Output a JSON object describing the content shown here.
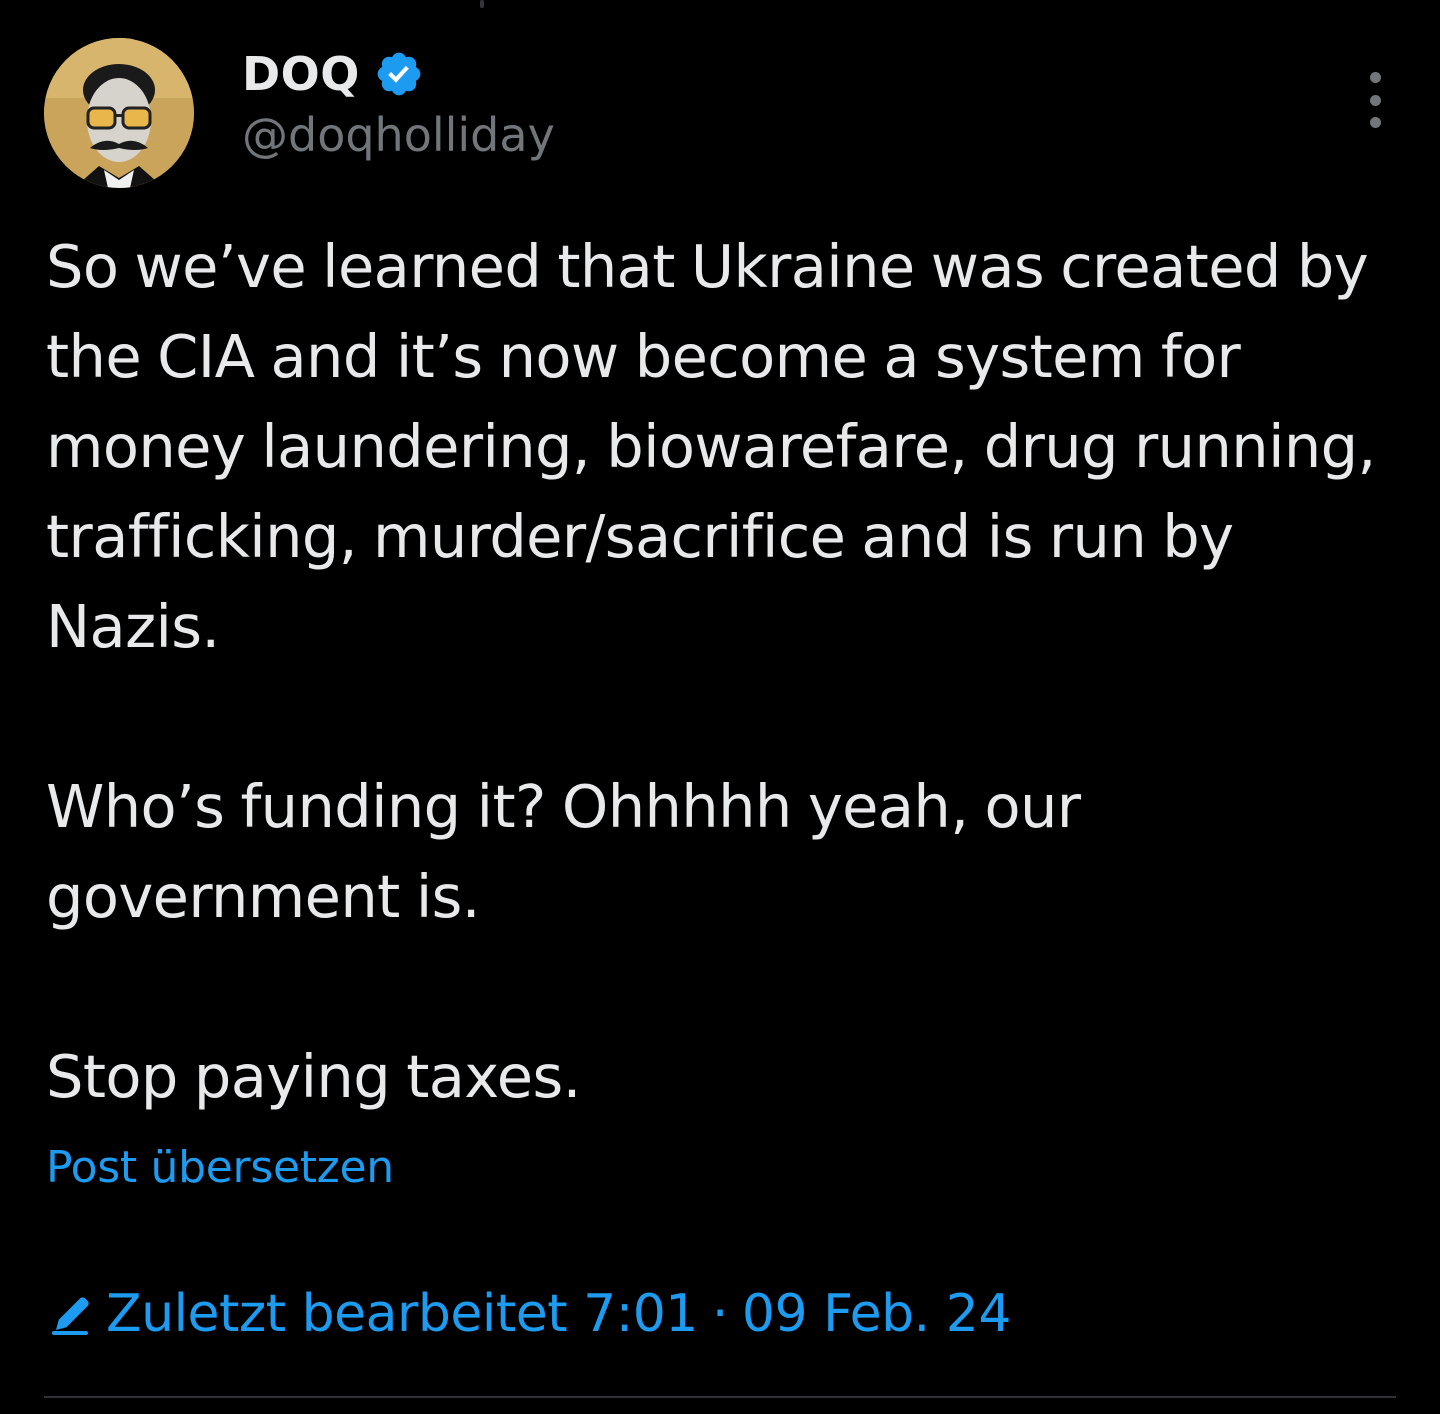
{
  "author": {
    "display_name": "DOQ",
    "handle": "@doqholliday",
    "verified": true
  },
  "tweet": {
    "text": "So we’ve learned that Ukraine was created by the CIA and it’s now become a system for money laundering, biowarefare, drug running, trafficking, murder/sacrifice and is run by Nazis.\n\nWho’s funding it? Ohhhhh yeah, our government is.\n\nStop paying taxes."
  },
  "translate_label": "Post übersetzen",
  "edit_info": {
    "label": "Zuletzt bearbeitet 7:01",
    "separator": "·",
    "date": "09 Feb. 24"
  },
  "icons": {
    "verified": "verified-badge-icon",
    "more": "more-vertical-icon",
    "edit": "pencil-edit-icon"
  },
  "colors": {
    "background": "#000000",
    "text": "#e7e9ea",
    "secondary": "#71767b",
    "accent": "#1d9bf0"
  }
}
